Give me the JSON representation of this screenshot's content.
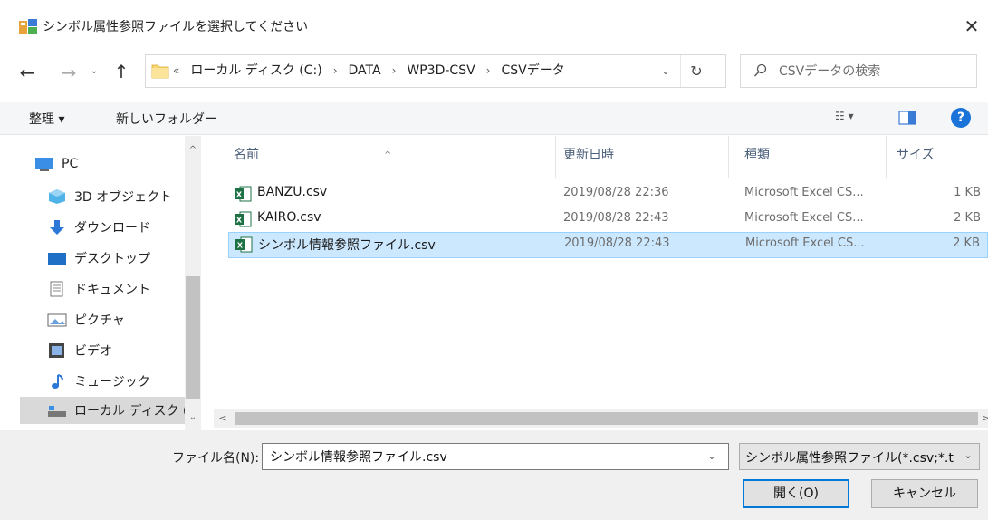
{
  "window": {
    "title": "シンボル属性参照ファイルを選択してください",
    "close_glyph": "✕"
  },
  "navigation": {
    "back_glyph": "←",
    "forward_glyph": "→",
    "recent_glyph": "⌄",
    "up_glyph": "↑",
    "refresh_glyph": "↻"
  },
  "address": {
    "overflow": "«",
    "crumbs": [
      "ローカル ディスク (C:)",
      "DATA",
      "WP3D-CSV",
      "CSVデータ"
    ],
    "separator": "›",
    "dropdown_glyph": "⌄"
  },
  "search": {
    "placeholder": "CSVデータの検索",
    "icon": "search-icon"
  },
  "toolbar": {
    "organize_label": "整理 ▾",
    "new_folder_label": "新しいフォルダー",
    "view_label": "☷ ▾",
    "help_label": "?"
  },
  "sidebar": {
    "items": [
      {
        "label": "PC",
        "icon": "pc-icon"
      },
      {
        "label": "3D オブジェクト",
        "icon": "3d-objects-icon"
      },
      {
        "label": "ダウンロード",
        "icon": "download-icon"
      },
      {
        "label": "デスクトップ",
        "icon": "desktop-icon"
      },
      {
        "label": "ドキュメント",
        "icon": "documents-icon"
      },
      {
        "label": "ピクチャ",
        "icon": "pictures-icon"
      },
      {
        "label": "ビデオ",
        "icon": "videos-icon"
      },
      {
        "label": "ミュージック",
        "icon": "music-icon"
      },
      {
        "label": "ローカル ディスク (C",
        "icon": "local-disk-icon"
      }
    ],
    "scroll_up": "^",
    "scroll_down": "⌄"
  },
  "filelist": {
    "columns": {
      "name": "名前",
      "date": "更新日時",
      "type": "種類",
      "size": "サイズ"
    },
    "sort_arrow": "^",
    "rows": [
      {
        "name": "BANZU.csv",
        "date": "2019/08/28 22:36",
        "type": "Microsoft Excel CS...",
        "size": "1 KB"
      },
      {
        "name": "KAIRO.csv",
        "date": "2019/08/28 22:43",
        "type": "Microsoft Excel CS...",
        "size": "2 KB"
      },
      {
        "name": "シンボル情報参照ファイル.csv",
        "date": "2019/08/28 22:43",
        "type": "Microsoft Excel CS...",
        "size": "2 KB"
      }
    ],
    "hscroll_left": "<",
    "hscroll_right": ">"
  },
  "bottom": {
    "filename_label": "ファイル名(N):",
    "filename_value": "シンボル情報参照ファイル.csv",
    "filetype_value": "シンボル属性参照ファイル(*.csv;*.t",
    "dropdown_glyph": "⌄",
    "open_label": "開く(O)",
    "cancel_label": "キャンセル"
  },
  "colors": {
    "selection": "#cce8ff",
    "accent": "#0078d7",
    "excel_green": "#1e7145",
    "folder_yellow": "#f8d775"
  }
}
